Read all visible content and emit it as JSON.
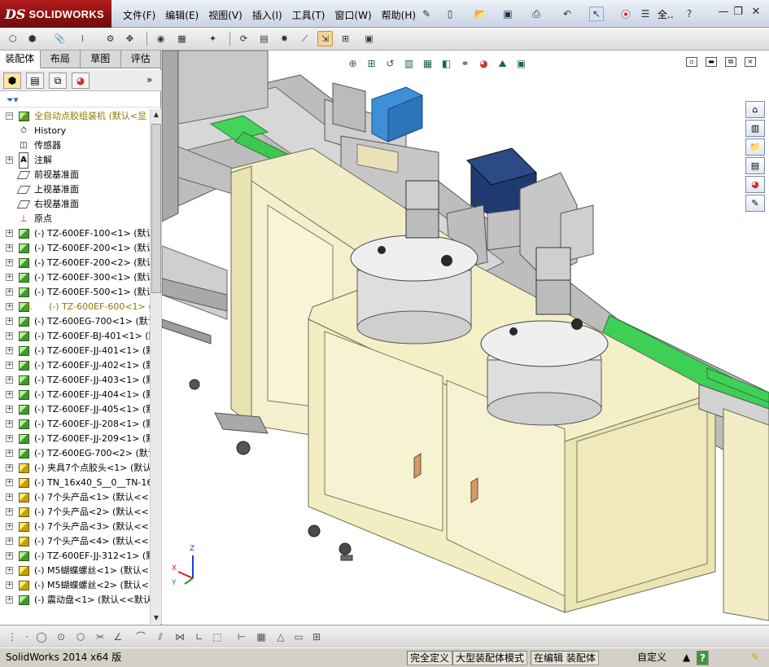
{
  "app": {
    "logo_prefix": "DS",
    "logo_name": "SOLIDWORKS"
  },
  "menu": [
    "文件(F)",
    "编辑(E)",
    "视图(V)",
    "插入(I)",
    "工具(T)",
    "窗口(W)",
    "帮助(H)"
  ],
  "search_text": "全..",
  "tabs": [
    "装配体",
    "布局",
    "草图",
    "评估"
  ],
  "tree": {
    "root": "全自动点胶组装机 (默认<显",
    "items": [
      {
        "label": "History",
        "icon": "history-icon",
        "kind": "system"
      },
      {
        "label": "传感器",
        "icon": "sensor-icon",
        "kind": "system"
      },
      {
        "label": "注解",
        "icon": "annotation-icon",
        "kind": "system",
        "expandable": true
      },
      {
        "label": "前视基准面",
        "icon": "plane-icon",
        "kind": "plane"
      },
      {
        "label": "上视基准面",
        "icon": "plane-icon",
        "kind": "plane"
      },
      {
        "label": "右视基准面",
        "icon": "plane-icon",
        "kind": "plane"
      },
      {
        "label": "原点",
        "icon": "origin-icon",
        "kind": "origin"
      },
      {
        "label": "(-) TZ-600EF-100<1> (默认<",
        "icon": "subassembly-icon",
        "kind": "asm"
      },
      {
        "label": "(-) TZ-600EF-200<1> (默认<",
        "icon": "subassembly-icon",
        "kind": "asm"
      },
      {
        "label": "(-) TZ-600EF-200<2> (默认<",
        "icon": "subassembly-icon",
        "kind": "asm"
      },
      {
        "label": "(-) TZ-600EF-300<1> (默认<",
        "icon": "subassembly-icon",
        "kind": "asm"
      },
      {
        "label": "(-) TZ-600EF-500<1> (默认<",
        "icon": "subassembly-icon",
        "kind": "asm"
      },
      {
        "label": "(-) TZ-600EF-600<1> (默",
        "icon": "subassembly-icon",
        "kind": "warn"
      },
      {
        "label": "(-) TZ-600EG-700<1> (默认<",
        "icon": "subassembly-icon",
        "kind": "asm"
      },
      {
        "label": "(-) TZ-600EF-BJ-401<1> (默",
        "icon": "subassembly-icon",
        "kind": "asm"
      },
      {
        "label": "(-) TZ-600EF-JJ-401<1> (默",
        "icon": "subassembly-icon",
        "kind": "asm"
      },
      {
        "label": "(-) TZ-600EF-JJ-402<1> (默",
        "icon": "subassembly-icon",
        "kind": "asm"
      },
      {
        "label": "(-) TZ-600EF-JJ-403<1> (默",
        "icon": "subassembly-icon",
        "kind": "asm"
      },
      {
        "label": "(-) TZ-600EF-JJ-404<1> (默",
        "icon": "subassembly-icon",
        "kind": "asm"
      },
      {
        "label": "(-) TZ-600EF-JJ-405<1> (默",
        "icon": "subassembly-icon",
        "kind": "asm"
      },
      {
        "label": "(-) TZ-600EF-JJ-208<1> (默",
        "icon": "subassembly-icon",
        "kind": "asm"
      },
      {
        "label": "(-) TZ-600EF-JJ-209<1> (默",
        "icon": "subassembly-icon",
        "kind": "asm"
      },
      {
        "label": "(-) TZ-600EG-700<2> (默认<",
        "icon": "subassembly-icon",
        "kind": "asm"
      },
      {
        "label": "(-) 夹具7个点胶头<1> (默认",
        "icon": "part-icon",
        "kind": "part"
      },
      {
        "label": "(-) TN_16x40_S__0__TN-16x",
        "icon": "part-icon",
        "kind": "part"
      },
      {
        "label": "(-) 7个头产品<1> (默认<<",
        "icon": "part-icon",
        "kind": "part"
      },
      {
        "label": "(-) 7个头产品<2> (默认<<",
        "icon": "part-icon",
        "kind": "part"
      },
      {
        "label": "(-) 7个头产品<3> (默认<<",
        "icon": "part-icon",
        "kind": "part"
      },
      {
        "label": "(-) 7个头产品<4> (默认<<",
        "icon": "part-icon",
        "kind": "part"
      },
      {
        "label": "(-) TZ-600EF-JJ-312<1> (默",
        "icon": "subassembly-icon",
        "kind": "asm"
      },
      {
        "label": "(-) M5蝴蝶螺丝<1> (默认<",
        "icon": "part-icon",
        "kind": "part"
      },
      {
        "label": "(-) M5蝴蝶螺丝<2> (默认<",
        "icon": "part-icon",
        "kind": "part"
      },
      {
        "label": "(-) 震动盘<1> (默认<<默认",
        "icon": "subassembly-icon",
        "kind": "asm"
      }
    ]
  },
  "status": {
    "app_version": "SolidWorks 2014 x64 版",
    "defined": "完全定义",
    "mode": "大型装配体模式",
    "editing": "在编辑 装配体",
    "units": "自定义",
    "help": "?"
  },
  "triad": {
    "x": "X",
    "y": "Y",
    "z": "Z"
  },
  "colors": {
    "frame": "#f3f0c8",
    "belt": "#3ecf54",
    "motor_box": "#3d8fd8",
    "tank": "#e6e6e6"
  }
}
